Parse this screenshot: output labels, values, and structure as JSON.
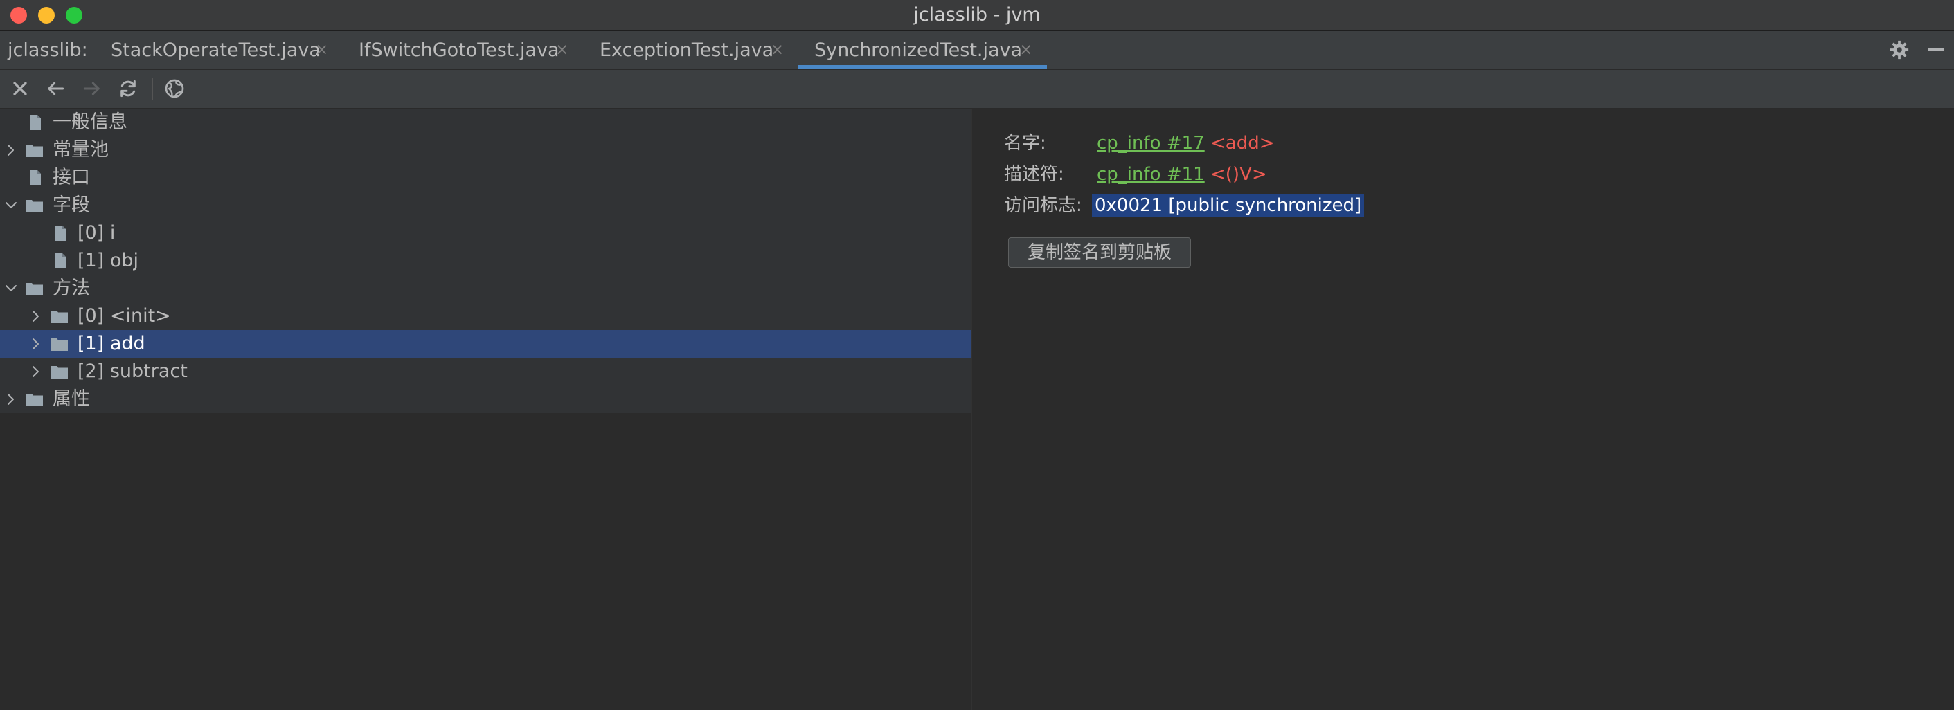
{
  "window": {
    "title": "jclasslib - jvm"
  },
  "tabbar": {
    "label": "jclasslib:",
    "tabs": [
      {
        "label": "StackOperateTest.java",
        "active": false
      },
      {
        "label": "IfSwitchGotoTest.java",
        "active": false
      },
      {
        "label": "ExceptionTest.java",
        "active": false
      },
      {
        "label": "SynchronizedTest.java",
        "active": true
      }
    ],
    "close_glyph": "×",
    "icons": [
      "gear-icon",
      "minimize-icon"
    ]
  },
  "toolbar": {
    "buttons": [
      "close-icon",
      "back-arrow-icon",
      "forward-arrow-icon",
      "refresh-icon",
      "globe-icon"
    ]
  },
  "tree": {
    "items": [
      {
        "label": "一般信息",
        "depth": 0,
        "expandable": false,
        "icon": "file-icon"
      },
      {
        "label": "常量池",
        "depth": 0,
        "expandable": true,
        "expanded": false,
        "icon": "folder-icon"
      },
      {
        "label": "接口",
        "depth": 0,
        "expandable": false,
        "icon": "file-icon"
      },
      {
        "label": "字段",
        "depth": 0,
        "expandable": true,
        "expanded": true,
        "icon": "folder-icon"
      },
      {
        "label": "[0] i",
        "depth": 1,
        "expandable": false,
        "icon": "file-icon"
      },
      {
        "label": "[1] obj",
        "depth": 1,
        "expandable": false,
        "icon": "file-icon"
      },
      {
        "label": "方法",
        "depth": 0,
        "expandable": true,
        "expanded": true,
        "icon": "folder-icon"
      },
      {
        "label": "[0] <init>",
        "depth": 1,
        "expandable": true,
        "expanded": false,
        "icon": "folder-icon"
      },
      {
        "label": "[1] add",
        "depth": 1,
        "expandable": true,
        "expanded": false,
        "icon": "folder-icon",
        "selected": true
      },
      {
        "label": "[2] subtract",
        "depth": 1,
        "expandable": true,
        "expanded": false,
        "icon": "folder-icon"
      },
      {
        "label": "属性",
        "depth": 0,
        "expandable": true,
        "expanded": false,
        "icon": "folder-icon"
      }
    ]
  },
  "detail": {
    "name_label": "名字:",
    "name_link": "cp_info #17",
    "name_value": "<add>",
    "descriptor_label": "描述符:",
    "descriptor_link": "cp_info #11",
    "descriptor_value": "<()V>",
    "access_label": "访问标志:",
    "access_value": "0x0021 [public synchronized]",
    "copy_button": "复制签名到剪贴板"
  },
  "colors": {
    "selection": "#2f4779",
    "link": "#6fbf55",
    "value_red": "#ec5a52",
    "active_tab_underline": "#4a88c7",
    "highlight": "#214283"
  }
}
